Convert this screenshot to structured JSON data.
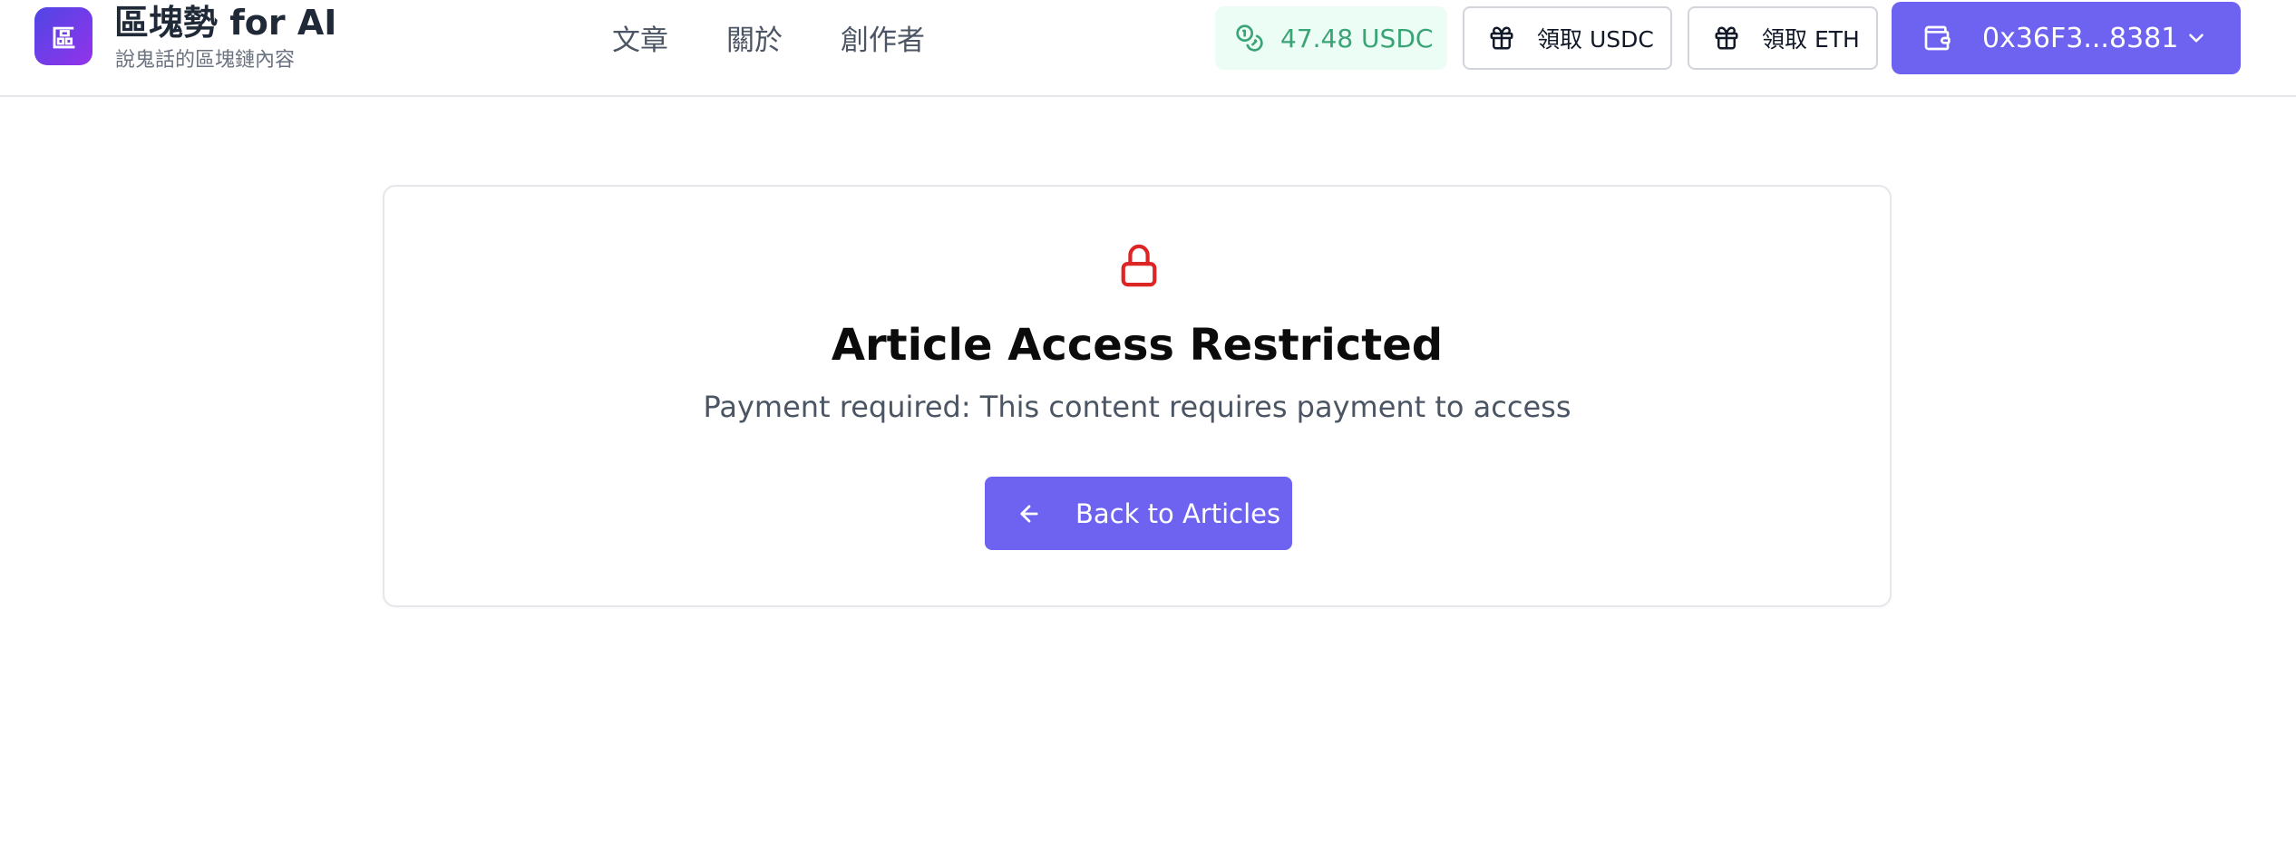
{
  "header": {
    "logo_glyph": "區",
    "title": "區塊勢 for AI",
    "subtitle": "說鬼話的區塊鏈內容",
    "nav": [
      {
        "label": "文章"
      },
      {
        "label": "關於"
      },
      {
        "label": "創作者"
      }
    ],
    "balance": {
      "text": "47.48 USDC",
      "icon": "coins-icon"
    },
    "claim_usdc": {
      "label": "領取 USDC",
      "icon": "gift-icon"
    },
    "claim_eth": {
      "label": "領取 ETH",
      "icon": "gift-icon"
    },
    "wallet": {
      "address": "0x36F3...8381",
      "icon": "wallet-icon"
    }
  },
  "restricted": {
    "icon": "lock-icon",
    "title": "Article Access Restricted",
    "message": "Payment required: This content requires payment to access",
    "back_label": "Back to Articles"
  },
  "colors": {
    "accent": "#6d63f0",
    "success": "#3aa476",
    "success_bg": "#ecfdf5",
    "lock": "#dc2626"
  }
}
